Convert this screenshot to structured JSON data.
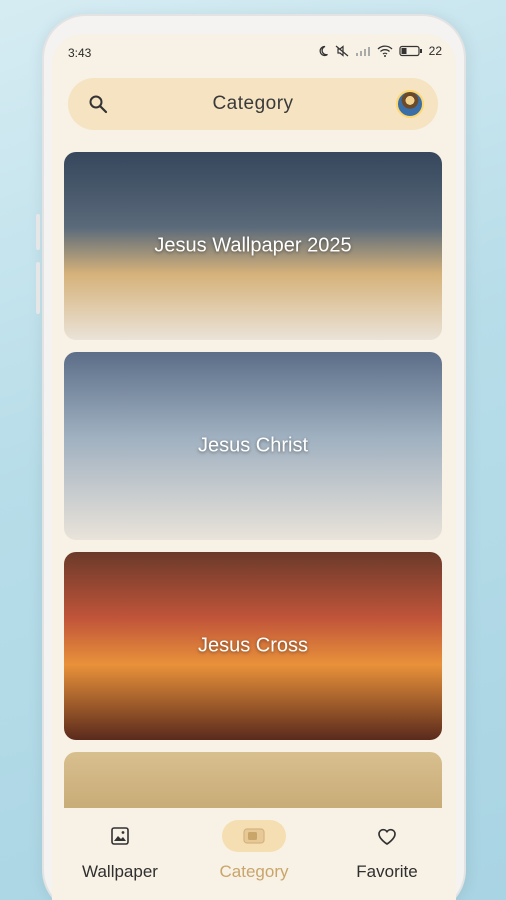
{
  "status_bar": {
    "time": "3:43",
    "battery": "22"
  },
  "header": {
    "title": "Category"
  },
  "categories": [
    {
      "label": "Jesus Wallpaper 2025"
    },
    {
      "label": "Jesus Christ"
    },
    {
      "label": "Jesus Cross"
    },
    {
      "label": ""
    }
  ],
  "bottom_nav": [
    {
      "label": "Wallpaper",
      "icon": "wallpaper-icon"
    },
    {
      "label": "Category",
      "icon": "category-icon",
      "active": true
    },
    {
      "label": "Favorite",
      "icon": "heart-icon"
    }
  ],
  "colors": {
    "accent": "#c9a56a",
    "header_bg": "#f5e3c2",
    "screen_bg": "#f8f1e5"
  }
}
